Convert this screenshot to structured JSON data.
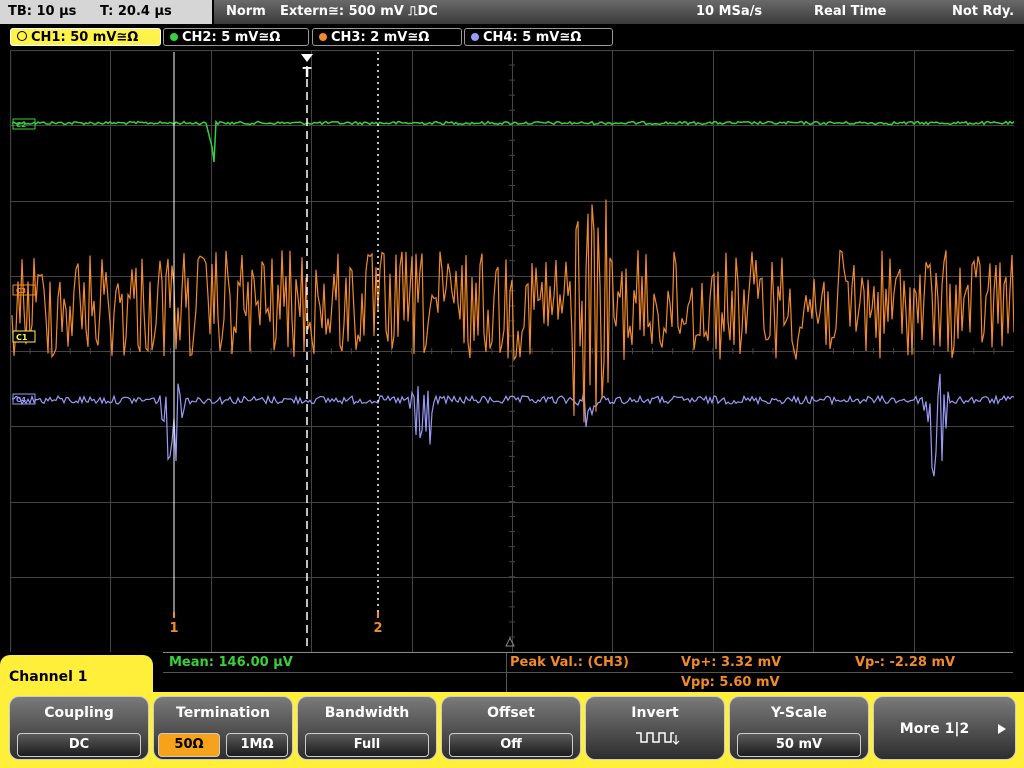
{
  "status_bar": {
    "timebase": "TB: 10 µs",
    "trigger_time": "T: 20.4 µs",
    "mode": "Norm",
    "trigger_source": "Extern≅: 500 mV ⎍DC",
    "sample_rate": "10 MSa/s",
    "acq_mode": "Real Time",
    "state": "Not Rdy."
  },
  "channels": [
    {
      "label": "CH1: 50 mV≅Ω",
      "color": "#fff34a",
      "active": true
    },
    {
      "label": "CH2: 5 mV≅Ω",
      "color": "#37d23a",
      "active": false
    },
    {
      "label": "CH3: 2 mV≅Ω",
      "color": "#f18a2a",
      "active": false
    },
    {
      "label": "CH4: 5 mV≅Ω",
      "color": "#9a9af6",
      "active": false
    }
  ],
  "plot": {
    "trigger_marker": "T",
    "cursor1_label": "1",
    "cursor2_label": "2",
    "ch_markers": [
      "C2",
      "C3",
      "C1",
      "C4"
    ]
  },
  "measurements": {
    "channel_tab": "Channel 1",
    "mean": "Mean: 146.00 µV",
    "peak_title": "Peak Val.: (CH3)",
    "vp_plus": "Vp+: 3.32 mV",
    "vp_minus": "Vp-: -2.28 mV",
    "vpp": "Vpp: 5.60 mV"
  },
  "softkeys": {
    "coupling": {
      "title": "Coupling",
      "value": "DC"
    },
    "termination": {
      "title": "Termination",
      "opt1": "50Ω",
      "opt2": "1MΩ"
    },
    "bandwidth": {
      "title": "Bandwidth",
      "value": "Full"
    },
    "offset": {
      "title": "Offset",
      "value": "Off"
    },
    "invert": {
      "title": "Invert"
    },
    "yscale": {
      "title": "Y-Scale",
      "value": "50 mV"
    },
    "more": {
      "title": "More 1|2"
    }
  },
  "colors": {
    "ch1": "#fff34a",
    "ch2": "#37d23a",
    "ch3": "#f18a2a",
    "ch4": "#9a9af6",
    "accent": "#ffef3a",
    "selected": "#f6a31b",
    "grid": "#444444"
  }
}
